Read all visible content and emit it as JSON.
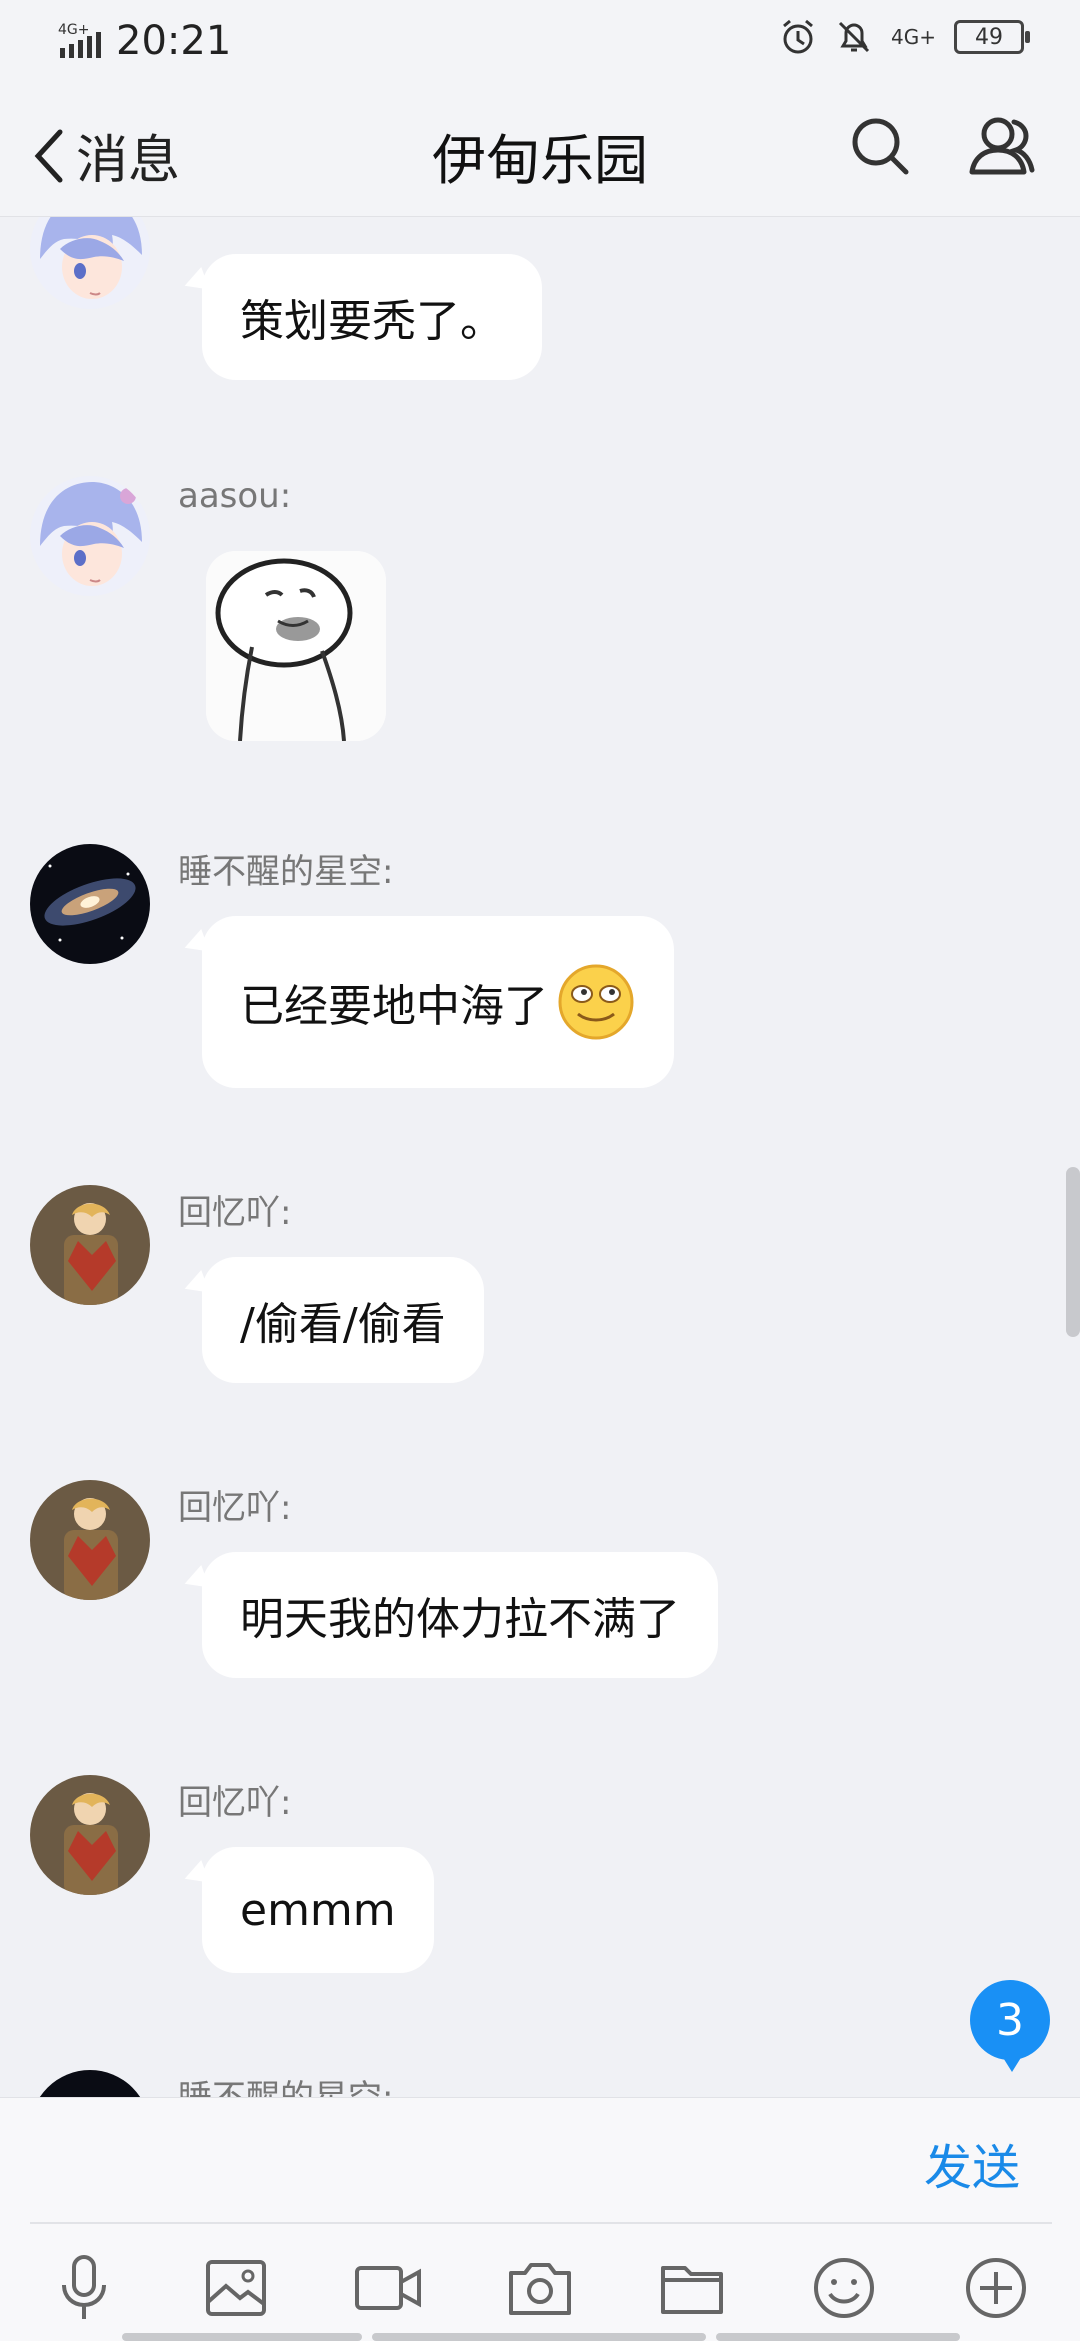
{
  "status": {
    "network_left": "4G+",
    "time": "20:21",
    "network_right": "4G+",
    "battery": "49"
  },
  "nav": {
    "back_label": "消息",
    "title": "伊甸乐园"
  },
  "messages": [
    {
      "sender": "",
      "text": "策划要秃了。"
    },
    {
      "sender": "aasou:",
      "text": ""
    },
    {
      "sender": "睡不醒的星空:",
      "text": "已经要地中海了"
    },
    {
      "sender": "回忆吖:",
      "text": "/偷看/偷看"
    },
    {
      "sender": "回忆吖:",
      "text": "明天我的体力拉不满了"
    },
    {
      "sender": "回忆吖:",
      "text": "emmm"
    },
    {
      "sender": "睡不醒的星空:",
      "text": ""
    }
  ],
  "unread_count": "3",
  "input": {
    "value": "",
    "send_label": "发送"
  },
  "toolbar": [
    "mic-icon",
    "image-icon",
    "video-icon",
    "camera-icon",
    "folder-icon",
    "emoji-icon",
    "plus-icon"
  ],
  "colors": {
    "accent": "#1990f5",
    "bubble": "#ffffff",
    "background": "#f0f1f5"
  }
}
